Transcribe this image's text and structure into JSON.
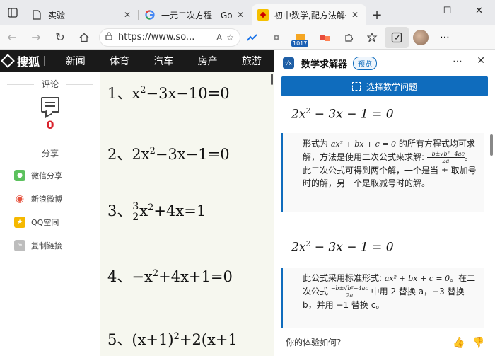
{
  "browser": {
    "tabs": [
      {
        "title": "实验",
        "favicon": "page-icon"
      },
      {
        "title": "一元二次方程 - Google 搜索",
        "favicon": "google-icon"
      },
      {
        "title": "初中数学,配方法解一元二次方程",
        "favicon": "sohu-icon"
      }
    ],
    "new_tab": "+",
    "window": {
      "minimize": "—",
      "maximize": "☐",
      "close": "✕"
    },
    "address": {
      "url": "https://www.so...",
      "read_aloud": "A",
      "favorite": "☆"
    },
    "extension_badge": "1017"
  },
  "page": {
    "nav": {
      "logo": "搜狐",
      "items": [
        "新闻",
        "体育",
        "汽车",
        "房产",
        "旅游"
      ]
    },
    "comments": {
      "title": "评论",
      "count": "0"
    },
    "share": {
      "title": "分享",
      "items": [
        {
          "label": "微信分享",
          "color": "#5cc15e"
        },
        {
          "label": "新浪微博",
          "color": "#e6523e"
        },
        {
          "label": "QQ空间",
          "color": "#f5b800"
        },
        {
          "label": "复制链接",
          "color": "#bdbdbd"
        }
      ]
    },
    "equations": [
      {
        "index": "1、",
        "pre": "x",
        "sup": "2",
        "post": "−3x−10=0"
      },
      {
        "index": "2、",
        "pre": "2x",
        "sup": "2",
        "post": "−3x−1=0"
      },
      {
        "index": "3、",
        "frac_num": "3",
        "frac_den": "2",
        "pre": "x",
        "sup": "2",
        "post": "+4x=1"
      },
      {
        "index": "4、",
        "pre": "−x",
        "sup": "2",
        "post": "+4x+1=0"
      },
      {
        "index": "5、",
        "pre": "(x+1)",
        "sup": "2",
        "post": "+2(x+1"
      }
    ]
  },
  "panel": {
    "title": "数学求解器",
    "badge": "预览",
    "select_button": "选择数学问题",
    "equation": {
      "pre": "2x",
      "sup": "2",
      "post": " − 3x − 1 = 0"
    },
    "card1": {
      "text_a": "形式为 ",
      "formula": "ax² + bx + c = 0",
      "text_b": " 的所有方程式均可求解，方法是使用二次公式来求解: ",
      "frac_num": "−b±√b²−4ac",
      "frac_den": "2a",
      "text_c": "。此二次公式可得到两个解，一个是当 ± 取加号时的解，另一个是取减号时的解。"
    },
    "equation2": {
      "pre": "2x",
      "sup": "2",
      "post": " − 3x − 1 = 0"
    },
    "card2": {
      "text_a": "此公式采用标准形式: ",
      "formula": "ax² + bx + c = 0",
      "text_b": "。在二次公式 ",
      "frac_num": "−b±√b²−4ac",
      "frac_den": "2a",
      "text_c": " 中用 2 替换 a，−3 替换 b，并用 −1 替换 c。"
    },
    "feedback": "你的体验如何?"
  }
}
